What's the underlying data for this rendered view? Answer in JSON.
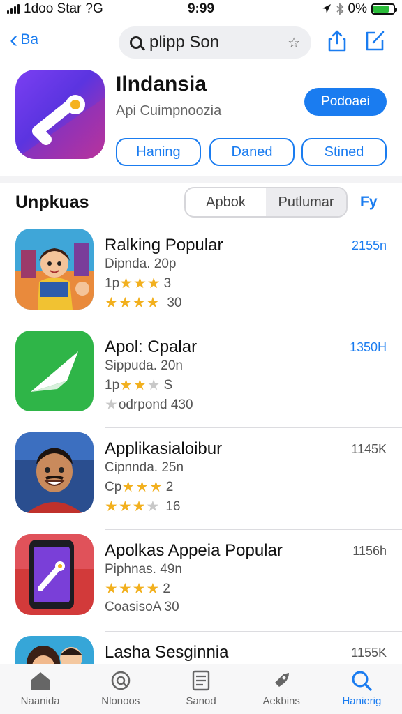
{
  "status_bar": {
    "carrier": "1doo Star",
    "network": "?G",
    "time": "9:99",
    "battery": "0%"
  },
  "nav": {
    "back_label": "Ba",
    "search_query": "plipp Son"
  },
  "featured_app": {
    "title": "Ilndansia",
    "subtitle": "Api Cuimpnoozia",
    "get_label": "Podoaei",
    "chips": [
      "Haning",
      "Daned",
      "Stined"
    ]
  },
  "section": {
    "title": "Unpkuas",
    "segments": [
      "Apbok",
      "Putlumar"
    ],
    "active_segment": "Putlumar",
    "filter_label": "Fy"
  },
  "apps": [
    {
      "name": "Ralking Popular",
      "dev": "Dipnda. 20p",
      "line3_prefix": "1p",
      "line3_rating": 3,
      "line3_suffix": "3",
      "line4_prefix": "",
      "line4_rating": 4,
      "line4_suffix": "30",
      "size": "2155n",
      "size_color": "#1a7cf0"
    },
    {
      "name": "Apol: Cpalar",
      "dev": "Sippuda. 20n",
      "line3_prefix": "1p",
      "line3_rating": 2.5,
      "line3_suffix": "S",
      "line4_prefix": "",
      "line4_rating": 0.5,
      "line4_suffix": "odrpond 430",
      "size": "1350H",
      "size_color": "#1a7cf0"
    },
    {
      "name": "Applikasialoibur",
      "dev": "Cipnnda. 25n",
      "line3_prefix": "Cp",
      "line3_rating": 3,
      "line3_suffix": "2",
      "line4_prefix": "",
      "line4_rating": 3.5,
      "line4_suffix": "16",
      "size": "1145K",
      "size_color": "#555555"
    },
    {
      "name": "Apolkas Appeia Popular",
      "dev": "Piphnas. 49n",
      "line3_prefix": "",
      "line3_rating": 4,
      "line3_suffix": "2",
      "line4_prefix": "",
      "line4_rating": 0,
      "line4_suffix": "CoasisoA 30",
      "size": "1156h",
      "size_color": "#555555"
    },
    {
      "name": "Lasha Sesginnia",
      "dev": "",
      "line3_prefix": "",
      "line3_rating": 0,
      "line3_suffix": "",
      "line4_prefix": "",
      "line4_rating": 0,
      "line4_suffix": "",
      "size": "1155K",
      "size_color": "#555555"
    }
  ],
  "tabbar": {
    "items": [
      "Naanida",
      "Nlonoos",
      "Sanod",
      "Aekbins",
      "Hanierig"
    ],
    "active_index": 4
  },
  "colors": {
    "accent": "#1a7cf0",
    "star": "#f2b01e"
  }
}
